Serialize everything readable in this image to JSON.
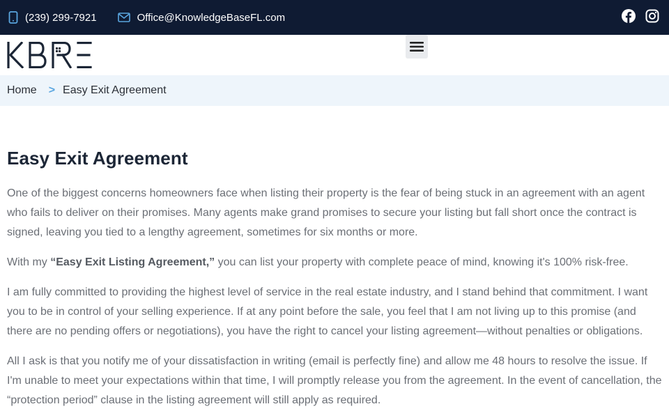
{
  "topbar": {
    "phone": "(239) 299-7921",
    "email": "Office@KnowledgeBaseFL.com",
    "socials": [
      {
        "icon": "facebook-icon"
      },
      {
        "icon": "instagram-icon"
      }
    ]
  },
  "header": {
    "logo_text": "KBRE",
    "menu_icon": "hamburger-menu-icon"
  },
  "breadcrumb": {
    "home": "Home",
    "separator": ">",
    "current": "Easy Exit Agreement"
  },
  "main": {
    "title": "Easy Exit Agreement",
    "paragraphs": [
      "One of the biggest concerns homeowners face when listing their property is the fear of being stuck in an agreement with an agent who fails to deliver on their promises. Many agents make grand promises to secure your listing but fall short once the contract is signed, leaving you tied to a lengthy agreement, sometimes for six months or more.",
      "I am fully committed to providing the highest level of service in the real estate industry, and I stand behind that commitment. I want you to be in control of your selling experience. If at any point before the sale, you feel that I am not living up to this promise (and there are no pending offers or negotiations), you have the right to cancel your listing agreement—without penalties or obligations.",
      "All I ask is that you notify me of your dissatisfaction in writing (email is perfectly fine) and allow me 48 hours to resolve the issue. If I'm unable to meet your expectations within that time, I will promptly release you from the agreement. In the event of cancellation, the “protection period” clause in the listing agreement will still apply as required."
    ],
    "easy_exit": {
      "prefix": "With my ",
      "emphasis": "“Easy Exit Listing Agreement,”",
      "suffix": " you can list your property with complete peace of mind, knowing it's 100% risk-free."
    }
  },
  "colors": {
    "topbar_bg": "#0f1b33",
    "accent": "#5aa6e0",
    "breadcrumb_bg": "#eef5fb",
    "title": "#1c2636",
    "body_text": "#6b6f76"
  }
}
